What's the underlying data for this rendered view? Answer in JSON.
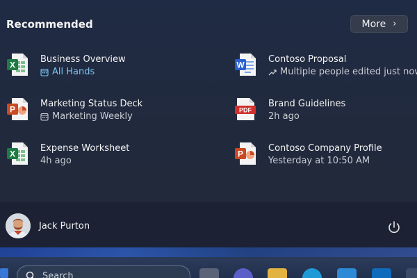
{
  "recommended": {
    "title": "Recommended",
    "more_label": "More",
    "items": [
      {
        "name": "Business Overview",
        "sub": "All Hands",
        "app": "excel",
        "sub_icon": "calendar-icon"
      },
      {
        "name": "Contoso Proposal",
        "sub": "Multiple people edited just now",
        "app": "word",
        "sub_icon": "trend-icon"
      },
      {
        "name": "Marketing Status Deck",
        "sub": "Marketing Weekly",
        "app": "powerpoint",
        "sub_icon": "calendar-icon"
      },
      {
        "name": "Brand Guidelines",
        "sub": "2h ago",
        "app": "pdf",
        "sub_icon": ""
      },
      {
        "name": "Expense Worksheet",
        "sub": "4h ago",
        "app": "excel",
        "sub_icon": ""
      },
      {
        "name": "Contoso Company Profile",
        "sub": "Yesterday at 10:50 AM",
        "app": "powerpoint",
        "sub_icon": ""
      }
    ]
  },
  "pdf_badge": "PDF",
  "user": {
    "name": "Jack Purton"
  },
  "taskbar": {
    "search_placeholder": "Search"
  },
  "colors": {
    "excel": "#1f7a45",
    "word": "#2b5fd0",
    "powerpoint": "#c94a23",
    "pdf": "#d0312d",
    "accent_link": "#7cc7f0"
  }
}
